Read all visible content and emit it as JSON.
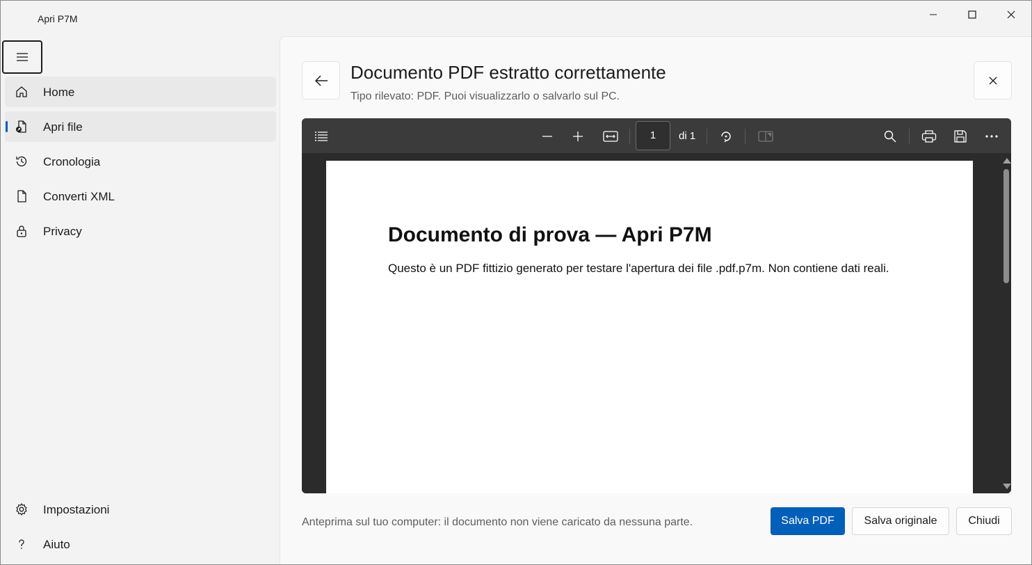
{
  "window": {
    "title": "Apri P7M"
  },
  "sidebar": {
    "items": [
      {
        "label": "Home",
        "icon": "home-icon"
      },
      {
        "label": "Apri file",
        "icon": "open-file-icon"
      },
      {
        "label": "Cronologia",
        "icon": "history-icon"
      },
      {
        "label": "Converti XML",
        "icon": "document-icon"
      },
      {
        "label": "Privacy",
        "icon": "lock-icon"
      }
    ],
    "footer_items": [
      {
        "label": "Impostazioni",
        "icon": "gear-icon"
      },
      {
        "label": "Aiuto",
        "icon": "help-icon"
      }
    ]
  },
  "header": {
    "title": "Documento PDF estratto correttamente",
    "subtitle": "Tipo rilevato: PDF. Puoi visualizzarlo o salvarlo sul PC."
  },
  "viewer": {
    "page_current": "1",
    "page_total": "di 1",
    "page_heading": "Documento di prova — Apri P7M",
    "page_body": "Questo è un PDF fittizio generato per testare l'apertura dei file .pdf.p7m. Non contiene dati reali."
  },
  "footer": {
    "note": "Anteprima sul tuo computer: il documento non viene caricato da nessuna parte.",
    "save_pdf": "Salva PDF",
    "save_original": "Salva originale",
    "close": "Chiudi"
  },
  "colors": {
    "accent": "#005fb8",
    "viewer_bg": "#383838"
  }
}
